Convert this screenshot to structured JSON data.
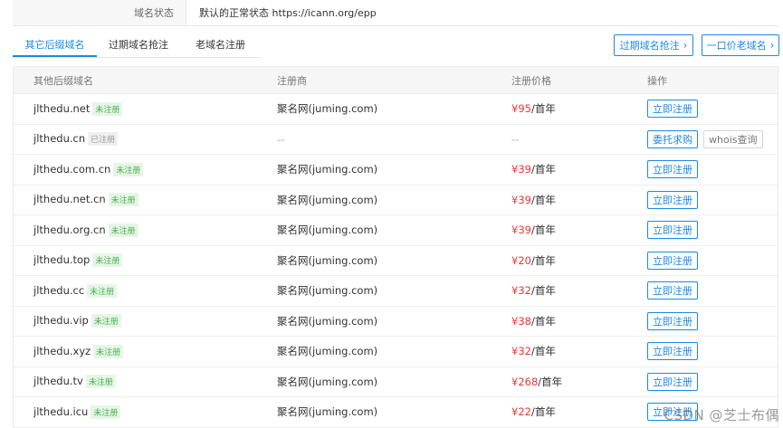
{
  "status": {
    "label": "域名状态",
    "value": "默认的正常状态 https://icann.org/epp"
  },
  "tabs": [
    {
      "label": "其它后缀域名"
    },
    {
      "label": "过期域名抢注"
    },
    {
      "label": "老域名注册"
    }
  ],
  "buttons": {
    "expired": "过期域名抢注",
    "old": "一口价老域名",
    "chevron": "›"
  },
  "table": {
    "headers": [
      "其他后缀域名",
      "注册商",
      "注册价格",
      "操作"
    ],
    "rows": [
      {
        "domain": "jlthedu.net",
        "badge": "未注册",
        "registrar": "聚名网(juming.com)",
        "yen": "¥",
        "price": "95",
        "unit": "/首年",
        "action": "立即注册"
      },
      {
        "domain": "jlthedu.cn",
        "badge": "已注册",
        "registrar": "--",
        "price_text": "--",
        "action": "委托求购",
        "action2": "whois查询"
      },
      {
        "domain": "jlthedu.com.cn",
        "badge": "未注册",
        "registrar": "聚名网(juming.com)",
        "yen": "¥",
        "price": "39",
        "unit": "/首年",
        "action": "立即注册"
      },
      {
        "domain": "jlthedu.net.cn",
        "badge": "未注册",
        "registrar": "聚名网(juming.com)",
        "yen": "¥",
        "price": "39",
        "unit": "/首年",
        "action": "立即注册"
      },
      {
        "domain": "jlthedu.org.cn",
        "badge": "未注册",
        "registrar": "聚名网(juming.com)",
        "yen": "¥",
        "price": "39",
        "unit": "/首年",
        "action": "立即注册"
      },
      {
        "domain": "jlthedu.top",
        "badge": "未注册",
        "registrar": "聚名网(juming.com)",
        "yen": "¥",
        "price": "20",
        "unit": "/首年",
        "action": "立即注册"
      },
      {
        "domain": "jlthedu.cc",
        "badge": "未注册",
        "registrar": "聚名网(juming.com)",
        "yen": "¥",
        "price": "32",
        "unit": "/首年",
        "action": "立即注册"
      },
      {
        "domain": "jlthedu.vip",
        "badge": "未注册",
        "registrar": "聚名网(juming.com)",
        "yen": "¥",
        "price": "38",
        "unit": "/首年",
        "action": "立即注册"
      },
      {
        "domain": "jlthedu.xyz",
        "badge": "未注册",
        "registrar": "聚名网(juming.com)",
        "yen": "¥",
        "price": "32",
        "unit": "/首年",
        "action": "立即注册"
      },
      {
        "domain": "jlthedu.tv",
        "badge": "未注册",
        "registrar": "聚名网(juming.com)",
        "yen": "¥",
        "price": "268",
        "unit": "/首年",
        "action": "立即注册"
      },
      {
        "domain": "jlthedu.icu",
        "badge": "未注册",
        "registrar": "聚名网(juming.com)",
        "yen": "¥",
        "price": "22",
        "unit": "/首年",
        "action": "立即注册"
      }
    ]
  },
  "watermark": "CSDN @芝士布偶"
}
